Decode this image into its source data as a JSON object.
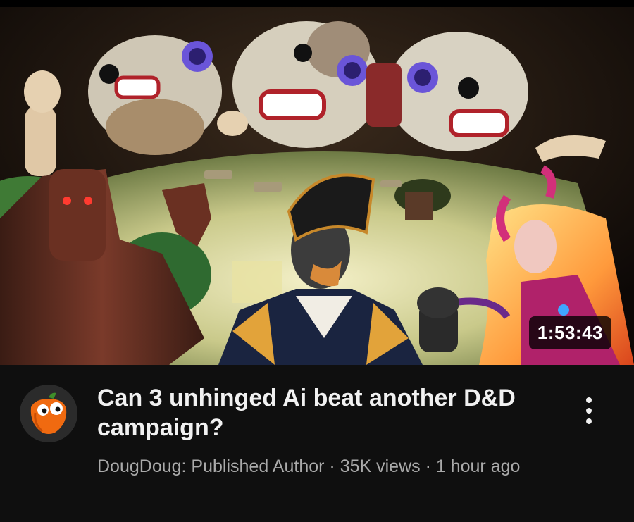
{
  "video": {
    "title": "Can 3 unhinged Ai beat another D&D campaign?",
    "duration": "1:53:43",
    "channel": "DougDoug: Published Author",
    "views": "35K views",
    "age": "1 hour ago",
    "separator": "·"
  },
  "icons": {
    "avatar": "pepper-mascot-icon",
    "menu": "more-vertical-icon"
  },
  "colors": {
    "background": "#0f0f0f",
    "title_text": "#f1f1f1",
    "meta_text": "#aaaaaa",
    "duration_bg": "#000000"
  }
}
